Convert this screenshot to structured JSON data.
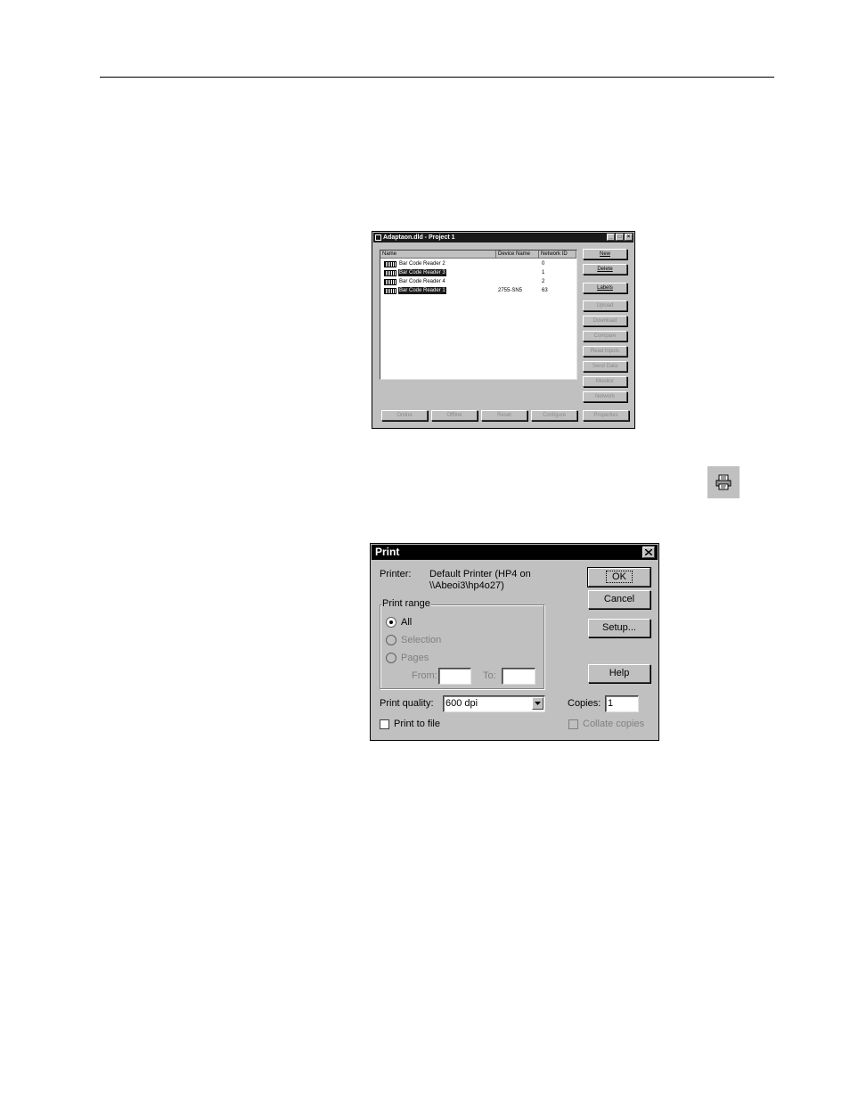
{
  "device_window": {
    "title": "Adaptaon.dld - Project 1",
    "columns": [
      "Name",
      "Device Name",
      "Network ID"
    ],
    "rows": [
      {
        "name": "Bar Code Reader 2",
        "device": "",
        "id": "0",
        "selected": false
      },
      {
        "name": "Bar Code Reader 3",
        "device": "",
        "id": "1",
        "selected": true
      },
      {
        "name": "Bar Code Reader 4",
        "device": "",
        "id": "2",
        "selected": false
      },
      {
        "name": "Bar Code Reader 1",
        "device": "2755-SN5",
        "id": "63",
        "selected": true
      }
    ],
    "side_buttons": [
      {
        "label": "New",
        "enabled": true
      },
      {
        "label": "Delete",
        "enabled": true
      },
      {
        "label": "Labels",
        "enabled": true
      },
      {
        "label": "Upload",
        "enabled": false
      },
      {
        "label": "Download",
        "enabled": false
      },
      {
        "label": "Compare",
        "enabled": false
      },
      {
        "label": "Read Inputs",
        "enabled": false
      },
      {
        "label": "Send Data",
        "enabled": false
      },
      {
        "label": "Monitor",
        "enabled": false
      },
      {
        "label": "Network",
        "enabled": false
      }
    ],
    "bottom_buttons": [
      "Online",
      "Offline",
      "Reset",
      "Configure",
      "Properties"
    ]
  },
  "toolbar": {
    "print_icon": "printer-icon"
  },
  "print_dialog": {
    "title": "Print",
    "printer_label": "Printer:",
    "printer_line1": "Default Printer (HP4 on",
    "printer_line2": "\\\\Abeoi3\\hp4o27)",
    "range_label": "Print range",
    "radio_all": "All",
    "radio_selection": "Selection",
    "radio_pages": "Pages",
    "from_label": "From:",
    "to_label": "To:",
    "quality_label": "Print quality:",
    "quality_value": "600 dpi",
    "copies_label": "Copies:",
    "copies_value": "1",
    "print_to_file": "Print to file",
    "collate": "Collate copies",
    "ok": "OK",
    "cancel": "Cancel",
    "setup": "Setup...",
    "help": "Help"
  }
}
